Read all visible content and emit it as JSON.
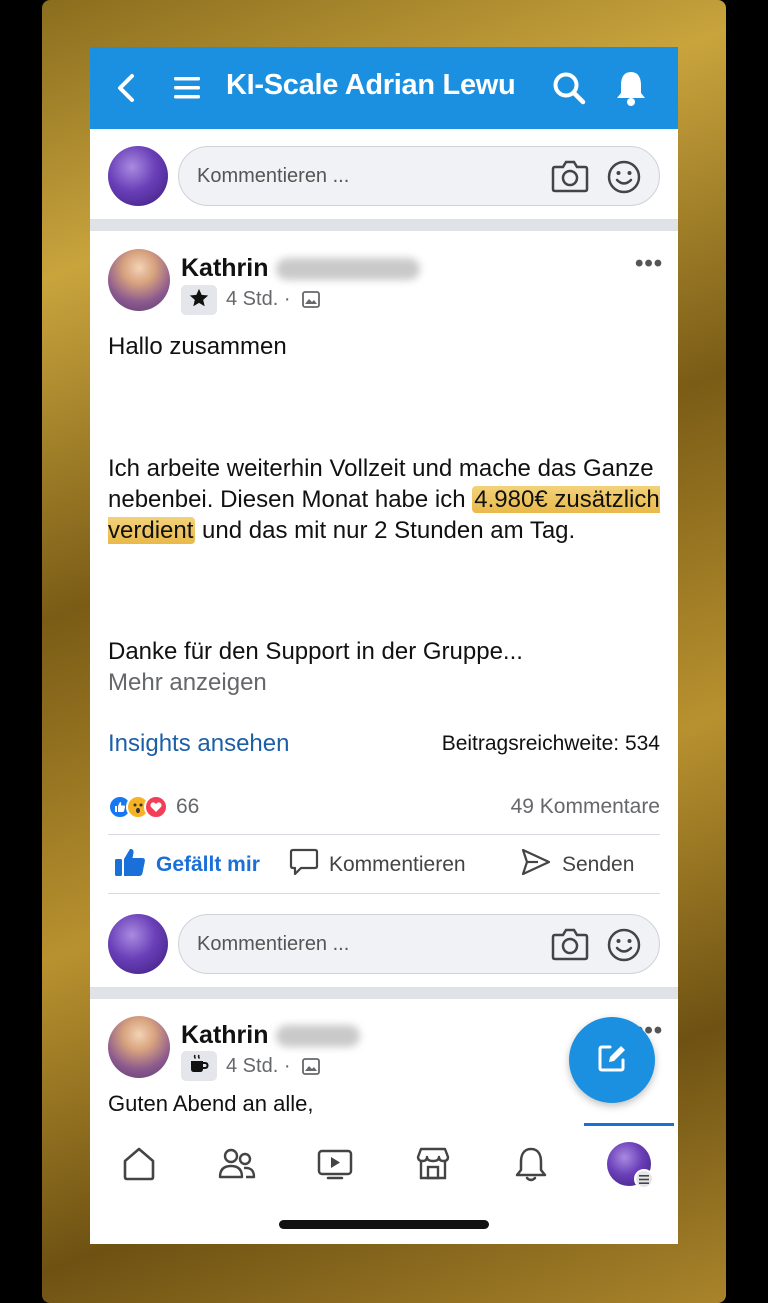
{
  "header": {
    "title": "KI-Scale Adrian Lewu"
  },
  "comment_box": {
    "placeholder": "Kommentieren ..."
  },
  "post1": {
    "author": "Kathrin",
    "time": "4 Std. ·",
    "greeting": "Hallo zusammen",
    "body_part1": "Ich arbeite weiterhin Vollzeit und mache das Ganze nebenbei. Diesen Monat habe ich ",
    "body_highlight": "4.980€ zusätzlich verdient",
    "body_part2": " und das mit nur 2 Stunden am Tag.",
    "thanks": "Danke für den Support in der Gruppe...",
    "more": "Mehr anzeigen",
    "insights": "Insights ansehen",
    "reach": "Beitragsreichweite: 534",
    "reaction_count": "66",
    "comment_count": "49 Kommentare",
    "actions": {
      "like": "Gefällt mir",
      "comment": "Kommentieren",
      "send": "Senden"
    }
  },
  "post2": {
    "author": "Kathrin",
    "time": "4 Std. ·",
    "text": "Guten Abend an alle,"
  },
  "colors": {
    "brand": "#1b8fe0",
    "like": "#1b6fd8",
    "highlight": "#e9b949"
  },
  "icons": [
    "back-icon",
    "menu-icon",
    "search-icon",
    "bell-icon",
    "camera-icon",
    "emoji-icon",
    "star-icon",
    "photo-icon",
    "more-icon",
    "like-icon",
    "comment-icon",
    "send-icon",
    "compose-icon",
    "home-icon",
    "friends-icon",
    "video-icon",
    "marketplace-icon",
    "notifications-icon",
    "coffee-icon"
  ]
}
